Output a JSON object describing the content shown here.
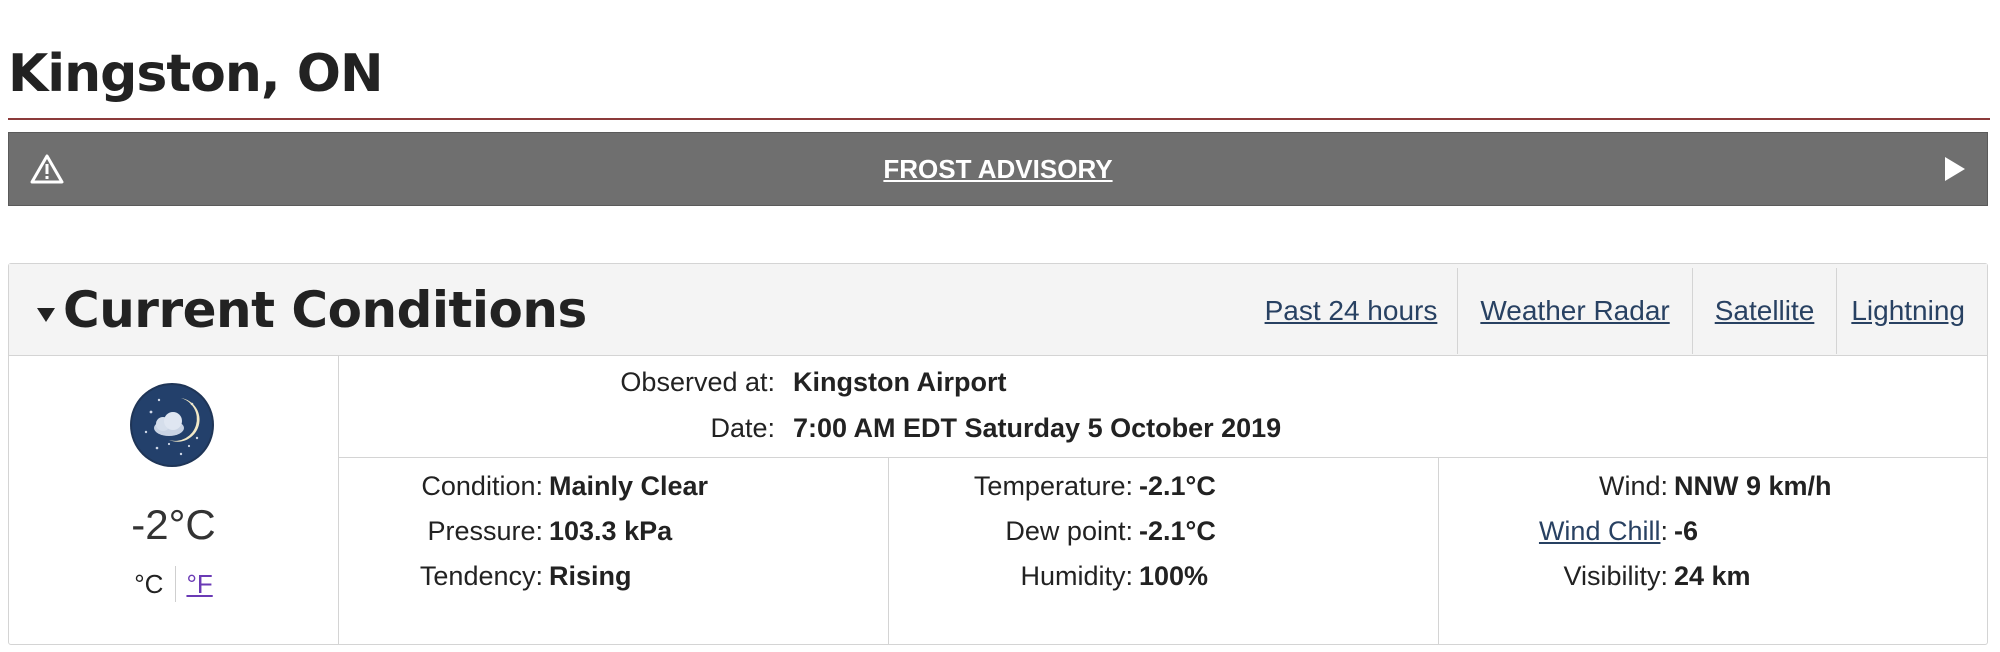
{
  "location": {
    "title": "Kingston, ON"
  },
  "alert": {
    "label": "FROST ADVISORY",
    "icon": "warning-triangle-icon",
    "arrow_icon": "play-arrow-icon",
    "background": "#6f6f6f"
  },
  "current_conditions": {
    "title": "Current Conditions",
    "links": [
      {
        "label": "Past 24 hours"
      },
      {
        "label": "Weather Radar"
      },
      {
        "label": "Satellite"
      },
      {
        "label": "Lightning"
      }
    ],
    "icon": "night-clear-moon-cloud-icon",
    "temperature": "-2°C",
    "units": {
      "celsius": "°C",
      "fahrenheit": "°F"
    },
    "observed_at": {
      "label": "Observed at:",
      "value": "Kingston Airport"
    },
    "date": {
      "label": "Date:",
      "value": "7:00 AM EDT Saturday 5 October 2019"
    },
    "columns": [
      [
        {
          "label": "Condition:",
          "value": "Mainly Clear"
        },
        {
          "label": "Pressure:",
          "value": "103.3 kPa"
        },
        {
          "label": "Tendency:",
          "value": "Rising"
        }
      ],
      [
        {
          "label": "Temperature:",
          "value": "-2.1°C"
        },
        {
          "label": "Dew point:",
          "value": "-2.1°C"
        },
        {
          "label": "Humidity:",
          "value": "100%"
        }
      ],
      [
        {
          "label": "Wind:",
          "value": "NNW 9 km/h"
        },
        {
          "label": "Wind Chill",
          "suffix": ":",
          "value": "-6"
        },
        {
          "label": "Visibility:",
          "value": "24 km"
        }
      ]
    ]
  },
  "colors": {
    "link": "#284162",
    "visited_link": "#6a3ab5",
    "title_rule": "#8b3a3a",
    "panel_header": "#f4f4f4"
  }
}
